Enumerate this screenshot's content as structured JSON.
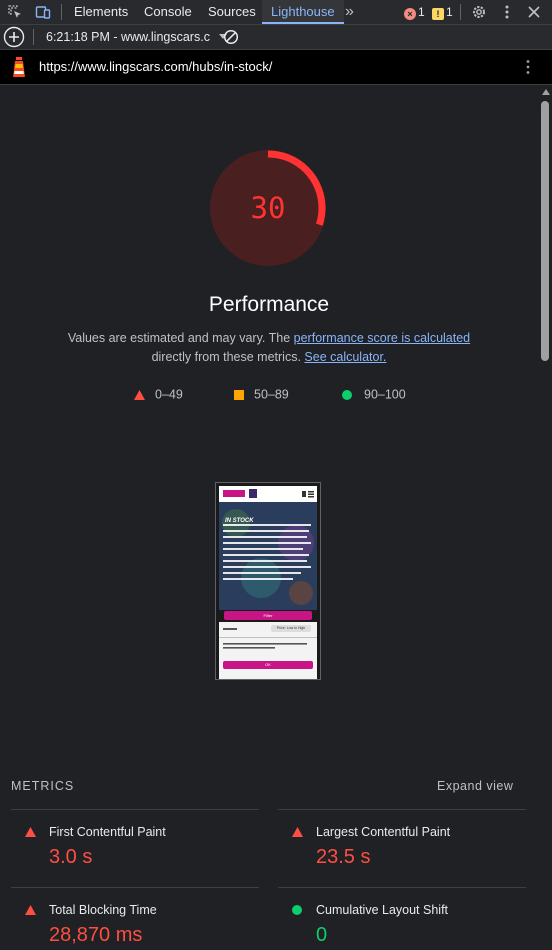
{
  "tabs": {
    "elements": "Elements",
    "console": "Console",
    "sources": "Sources",
    "lighthouse": "Lighthouse",
    "more": "»"
  },
  "badges": {
    "errors": "1",
    "warnings": "1"
  },
  "toolbar": {
    "report_select": "6:21:18 PM - www.lingscars.c"
  },
  "url": "https://www.lingscars.com/hubs/in-stock/",
  "score": {
    "value": "30",
    "fraction": 0.3,
    "color": "#ff3333"
  },
  "performance": {
    "title": "Performance",
    "desc_prefix": "Values are estimated and may vary. The ",
    "desc_link1": "performance score is calculated",
    "desc_mid": "directly from these metrics. ",
    "desc_link2": "See calculator."
  },
  "legend": {
    "fail": "0–49",
    "average": "50–89",
    "pass": "90–100"
  },
  "colors": {
    "fail": "#ff4e42",
    "average": "#ffa400",
    "pass": "#0cce6b",
    "link": "#8ab4f8"
  },
  "screenshot": {
    "heading": "IN STOCK",
    "filter_button": "Filter",
    "sort": "Price: Low to High",
    "ok": "OK"
  },
  "metrics": {
    "header": "METRICS",
    "expand": "Expand view",
    "items": [
      {
        "title": "First Contentful Paint",
        "value": "3.0 s",
        "status": "fail"
      },
      {
        "title": "Largest Contentful Paint",
        "value": "23.5 s",
        "status": "fail"
      },
      {
        "title": "Total Blocking Time",
        "value": "28,870 ms",
        "status": "fail"
      },
      {
        "title": "Cumulative Layout Shift",
        "value": "0",
        "status": "pass"
      }
    ]
  }
}
